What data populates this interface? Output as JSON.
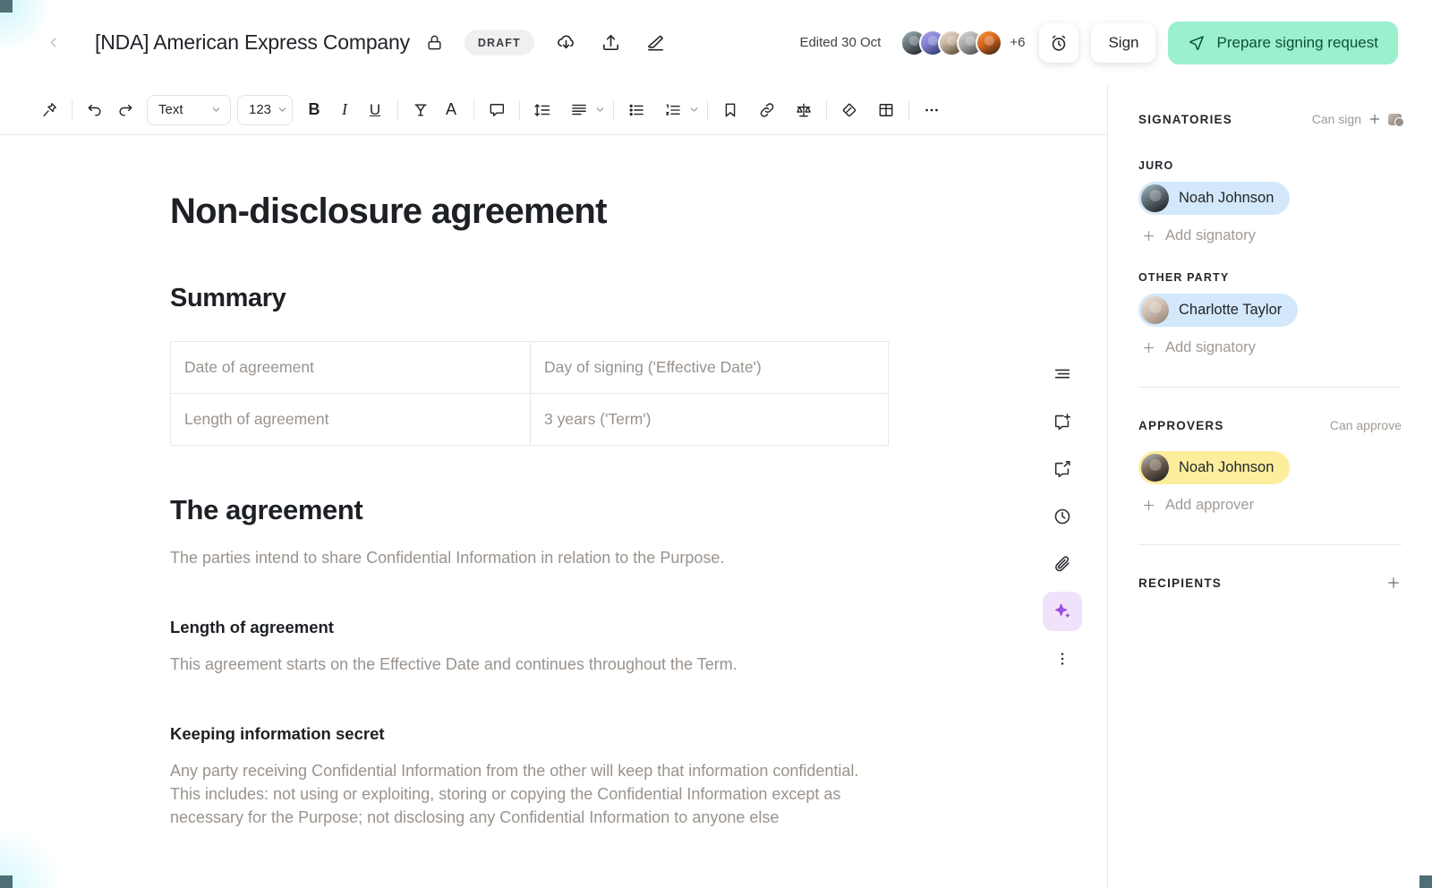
{
  "header": {
    "back_icon": "chevron-left-icon",
    "title": "[NDA] American Express Company",
    "lock_icon": "lock-icon",
    "status_badge": "DRAFT",
    "actions": [
      {
        "icon": "cloud-download-icon",
        "name": "download-button"
      },
      {
        "icon": "upload-icon",
        "name": "upload-button"
      },
      {
        "icon": "eraser-icon",
        "name": "eraser-button"
      }
    ],
    "edited_label": "Edited 30 Oct",
    "avatar_overflow": "+6",
    "avatar_count": 5,
    "reminder_icon": "alarm-clock-icon",
    "sign_label": "Sign",
    "prepare_label": "Prepare signing request",
    "prepare_icon": "send-paper-plane-icon",
    "prepare_bg": "#9bf0cd",
    "prepare_fg": "#0d5139"
  },
  "toolbar": {
    "items": [
      {
        "name": "pin-icon",
        "icon": "pin"
      },
      {
        "name": "undo-button",
        "icon": "undo"
      },
      {
        "name": "redo-button",
        "icon": "redo"
      }
    ],
    "style_select_value": "Text",
    "number_select_value": "123",
    "bold_label": "B",
    "italic_label": "I",
    "underline_label": "U",
    "clear_format_icon": "clear-formatting-icon",
    "text_color_label": "A",
    "comment_icon": "comment-icon",
    "line_spacing_icon": "line-spacing-icon",
    "align_icon": "align-icon",
    "bullet_list_icon": "bullet-list-icon",
    "numbered_list_icon": "numbered-list-icon",
    "bookmark_icon": "bookmark-icon",
    "link_icon": "link-icon",
    "clause_icon": "scales-icon",
    "tag_icon": "tag-icon",
    "table_icon": "table-icon",
    "more_icon": "more-horizontal-icon"
  },
  "document": {
    "title": "Non-disclosure agreement",
    "summary_heading": "Summary",
    "summary_table": [
      [
        "Date of agreement",
        "Day of signing ('Effective Date')"
      ],
      [
        "Length of agreement",
        "3 years ('Term')"
      ]
    ],
    "agreement_heading": "The agreement",
    "agreement_intro": "The parties intend to share Confidential Information in relation to the Purpose.",
    "length_heading": "Length of agreement",
    "length_body": "This agreement starts on the Effective Date and continues throughout the Term.",
    "secret_heading": "Keeping information secret",
    "secret_body": "Any party receiving Confidential Information from the other will keep that information confidential. This includes: not using or exploiting, storing or copying the Confidential Information except as necessary for the Purpose; not disclosing any Confidential Information to anyone else"
  },
  "rail": {
    "items": [
      {
        "name": "summary-icon",
        "icon": "text-lines"
      },
      {
        "name": "add-comment-icon",
        "icon": "comment-plus"
      },
      {
        "name": "share-comment-icon",
        "icon": "comment-share"
      },
      {
        "name": "history-icon",
        "icon": "clock"
      },
      {
        "name": "attachment-icon",
        "icon": "paperclip"
      },
      {
        "name": "ai-assistant-icon",
        "icon": "sparkle"
      },
      {
        "name": "more-vertical-icon",
        "icon": "dots-vertical"
      }
    ],
    "ai_bg": "#f0e2fb",
    "ai_fg": "#a04de0"
  },
  "sidebar": {
    "signatories": {
      "title": "SIGNATORIES",
      "hint": "Can sign",
      "groups": [
        {
          "label": "JURO",
          "person": "Noah Johnson",
          "add_label": "Add signatory",
          "chip_color": "#d3e8fa"
        },
        {
          "label": "OTHER PARTY",
          "person": "Charlotte Taylor",
          "add_label": "Add signatory",
          "chip_color": "#d3e8fa"
        }
      ]
    },
    "approvers": {
      "title": "APPROVERS",
      "hint": "Can approve",
      "person": "Noah Johnson",
      "add_label": "Add approver",
      "chip_color": "#fcee9d"
    },
    "recipients": {
      "title": "RECIPIENTS",
      "add_icon": "plus-icon"
    }
  }
}
